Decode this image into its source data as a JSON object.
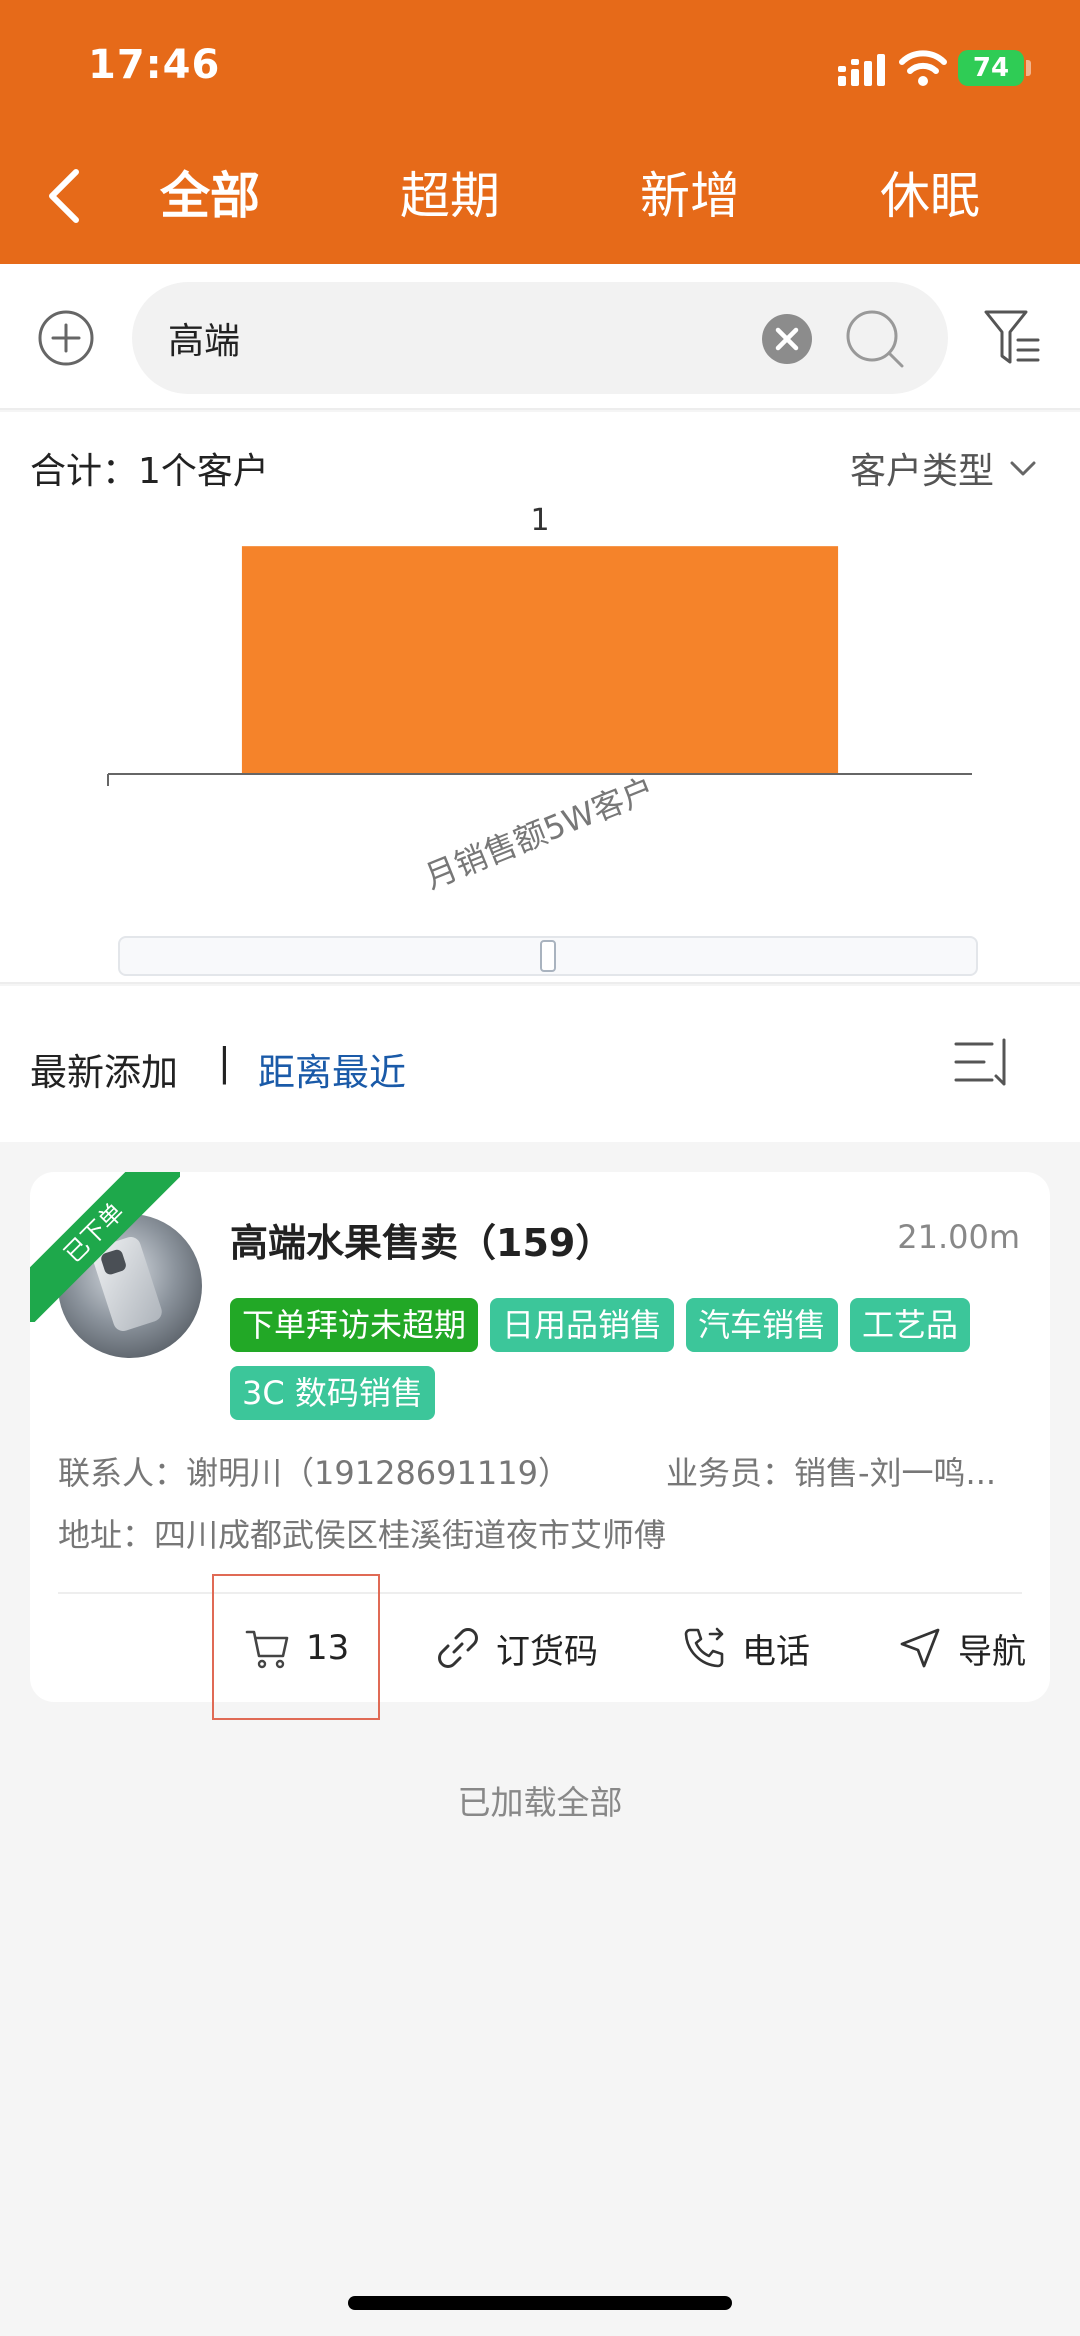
{
  "status_bar": {
    "time": "17:46",
    "battery": "74"
  },
  "nav": {
    "tabs": [
      "全部",
      "超期",
      "新增",
      "休眠"
    ],
    "active_index": 0
  },
  "search": {
    "value": "高端"
  },
  "summary": {
    "total": "合计：1个客户",
    "type_select": "客户类型"
  },
  "chart_data": {
    "type": "bar",
    "categories": [
      "月销售额5W客户"
    ],
    "values": [
      1
    ],
    "data_labels": [
      "1"
    ],
    "ylim": [
      0,
      1.15
    ],
    "color": "#F5832A"
  },
  "sort": {
    "option_a": "最新添加",
    "separator": "|",
    "option_b": "距离最近"
  },
  "customers": [
    {
      "ribbon": "已下单",
      "name": "高端水果售卖（159）",
      "distance": "21.00m",
      "tags": [
        "下单拜访未超期",
        "日用品销售",
        "汽车销售",
        "工艺品",
        "3C 数码销售"
      ],
      "contact": "联系人：谢明川（19128691119）",
      "salesman": "业务员：销售-刘一鸣...",
      "address": "地址：四川成都武侯区桂溪街道夜市艾师傅",
      "cart_count": "13",
      "order_code_label": "订货码",
      "phone_label": "电话",
      "navigate_label": "导航"
    }
  ],
  "footer": {
    "loaded_text": "已加载全部"
  },
  "colors": {
    "header": "#E66A19",
    "bar": "#F5832A",
    "tag_teal": "#3CC69A",
    "tag_green": "#22A826",
    "link_blue": "#1A5AA8"
  }
}
